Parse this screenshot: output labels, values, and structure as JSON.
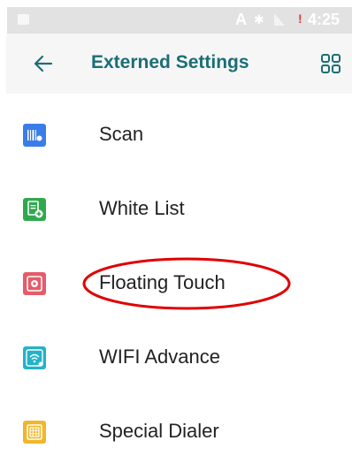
{
  "status_bar": {
    "time": "4:25",
    "keyboard_indicator": "A",
    "icons": [
      "notification-icon",
      "keyboard-icon",
      "bluetooth-icon",
      "signal-icon",
      "alert-icon"
    ]
  },
  "toolbar": {
    "title": "Externed Settings",
    "back_icon": "arrow-back-icon",
    "menu_icon": "grid-view-icon",
    "title_color": "#1b6e76"
  },
  "settings_list": [
    {
      "label": "Scan",
      "icon": "scan-icon",
      "color": "#3b7de8"
    },
    {
      "label": "White List",
      "icon": "white-list-icon",
      "color": "#2fa94e"
    },
    {
      "label": "Floating Touch",
      "icon": "floating-touch-icon",
      "color": "#e65b6a"
    },
    {
      "label": "WIFI Advance",
      "icon": "wifi-advance-icon",
      "color": "#22b2c9"
    },
    {
      "label": "Special Dialer",
      "icon": "special-dialer-icon",
      "color": "#f2b62a"
    }
  ],
  "annotation": {
    "shape": "ellipse",
    "color": "#e00000",
    "highlighted_item": "Floating Touch"
  }
}
